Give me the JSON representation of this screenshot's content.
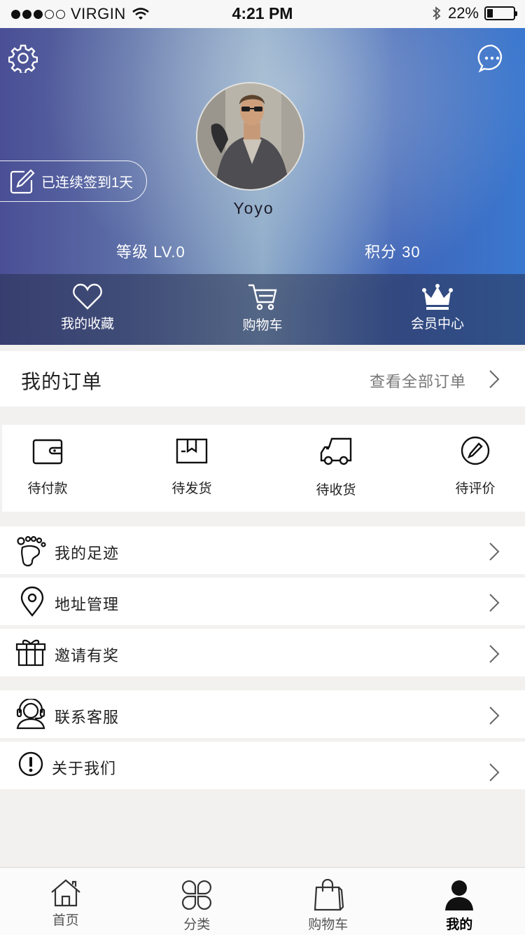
{
  "status_bar": {
    "carrier": "VIRGIN",
    "signal_bars": 3,
    "time": "4:21 PM",
    "battery": "22%",
    "battery_level": 0.22,
    "icons": [
      "signal-dots-icon",
      "wifi-icon",
      "bluetooth-icon",
      "battery-icon"
    ]
  },
  "header": {
    "settings_icon": "gear-icon",
    "message_icon": "chat-bubble-icon",
    "username": "Yoyo",
    "checkin": "已连续签到1天",
    "level": "等级 LV.0",
    "points": "积分 30",
    "quick": [
      {
        "label": "我的收藏",
        "icon": "heart-icon"
      },
      {
        "label": "购物车",
        "icon": "cart-icon"
      },
      {
        "label": "会员中心",
        "icon": "crown-icon"
      }
    ]
  },
  "orders": {
    "title": "我的订单",
    "view_all": "查看全部订单",
    "states": [
      {
        "label": "待付款",
        "icon": "wallet-icon"
      },
      {
        "label": "待发货",
        "icon": "package-icon"
      },
      {
        "label": "待收货",
        "icon": "truck-icon"
      },
      {
        "label": "待评价",
        "icon": "pen-circle-icon"
      }
    ]
  },
  "menu": [
    {
      "label": "我的足迹",
      "icon": "footprint-icon"
    },
    {
      "label": "地址管理",
      "icon": "location-pin-icon"
    },
    {
      "label": "邀请有奖",
      "icon": "gift-icon"
    },
    {
      "label": "联系客服",
      "icon": "headset-icon"
    },
    {
      "label": "关于我们",
      "icon": "info-exclamation-icon"
    }
  ],
  "tabbar": [
    {
      "label": "首页",
      "icon": "home-icon",
      "active": false
    },
    {
      "label": "分类",
      "icon": "category-icon",
      "active": false
    },
    {
      "label": "购物车",
      "icon": "shopping-bag-icon",
      "active": false
    },
    {
      "label": "我的",
      "icon": "user-icon",
      "active": true
    }
  ]
}
